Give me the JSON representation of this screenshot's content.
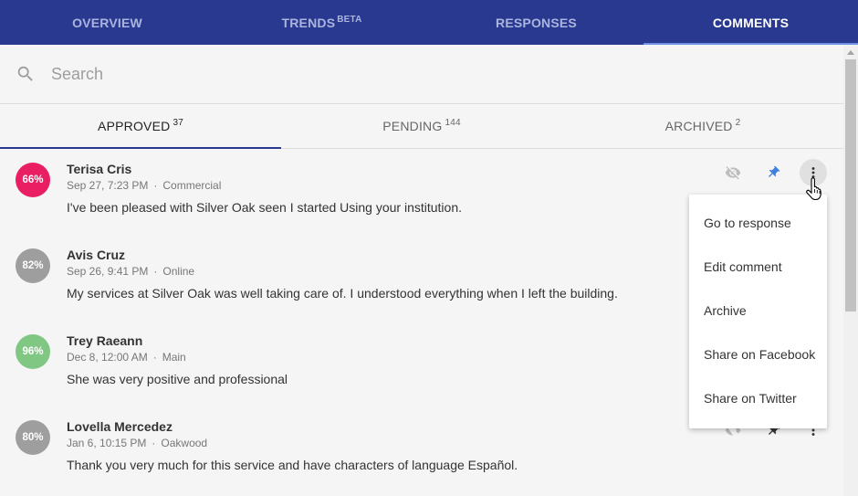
{
  "nav": {
    "tabs": [
      {
        "label": "OVERVIEW"
      },
      {
        "label": "TRENDS",
        "badge": "BETA"
      },
      {
        "label": "RESPONSES"
      },
      {
        "label": "COMMENTS"
      }
    ],
    "active": "COMMENTS"
  },
  "search": {
    "placeholder": "Search",
    "value": ""
  },
  "subtabs": [
    {
      "label": "APPROVED",
      "count": "37"
    },
    {
      "label": "PENDING",
      "count": "144"
    },
    {
      "label": "ARCHIVED",
      "count": "2"
    }
  ],
  "comments": [
    {
      "score": "66%",
      "score_color": "#e91e63",
      "name": "Terisa Cris",
      "date": "Sep 27, 7:23 PM",
      "location": "Commercial",
      "text": "I've been pleased with Silver Oak seen I started Using your institution.",
      "pinned": true
    },
    {
      "score": "82%",
      "score_color": "#9e9e9e",
      "name": "Avis Cruz",
      "date": "Sep 26, 9:41 PM",
      "location": "Online",
      "text": "My services at Silver Oak was well taking care of. I understood everything when I left the building."
    },
    {
      "score": "96%",
      "score_color": "#81c784",
      "name": "Trey Raeann",
      "date": "Dec 8, 12:00 AM",
      "location": "Main",
      "text": "She was very positive and professional"
    },
    {
      "score": "80%",
      "score_color": "#9e9e9e",
      "name": "Lovella Mercedez",
      "date": "Jan 6, 10:15 PM",
      "location": "Oakwood",
      "text": "Thank you very much for this service and have characters of language Español.",
      "pinned": false
    }
  ],
  "meta_separator": "·",
  "menu": {
    "items": [
      "Go to response",
      "Edit comment",
      "Archive",
      "Share on Facebook",
      "Share on Twitter"
    ]
  },
  "colors": {
    "nav_bg": "#2a3990",
    "pin_active": "#3f7fe0",
    "icon_gray": "#9e9e9e",
    "icon_dark": "#333333"
  }
}
